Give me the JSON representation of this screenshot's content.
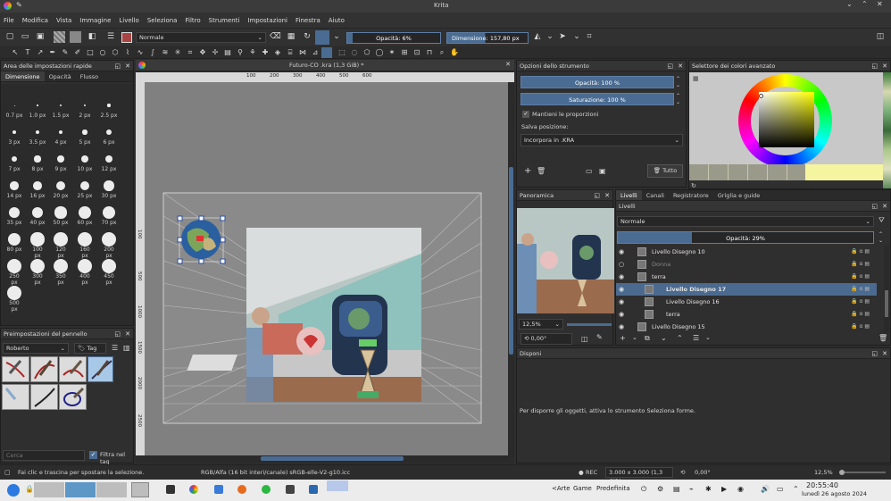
{
  "window": {
    "title": "Krita"
  },
  "menu": [
    "File",
    "Modifica",
    "Vista",
    "Immagine",
    "Livello",
    "Seleziona",
    "Filtro",
    "Strumenti",
    "Impostazioni",
    "Finestra",
    "Aiuto"
  ],
  "toolbar": {
    "blend_mode": "Normale",
    "opacity_label": "Opacità: 6%",
    "size_label": "Dimensione:",
    "size_value": "157,80 px"
  },
  "quick_settings": {
    "title": "Area delle impostazioni rapide",
    "tabs": [
      "Dimensione",
      "Opacità",
      "Flusso"
    ],
    "sizes": [
      "0.7 px",
      "1.0 px",
      "1.5 px",
      "2 px",
      "2.5 px",
      "3 px",
      "3.5 px",
      "4 px",
      "5 px",
      "6 px",
      "7 px",
      "8 px",
      "9 px",
      "10 px",
      "12 px",
      "14 px",
      "16 px",
      "20 px",
      "25 px",
      "30 px",
      "35 px",
      "40 px",
      "50 px",
      "60 px",
      "70 px",
      "80 px",
      "100 px",
      "120 px",
      "160 px",
      "200 px",
      "250 px",
      "300 px",
      "350 px",
      "400 px",
      "450 px",
      "500 px"
    ]
  },
  "brush_presets": {
    "title": "Preimpostazioni del pennello",
    "preset_select": "Roberto",
    "tag_select": "Tag",
    "search_placeholder": "Cerca",
    "filter_label": "Filtra nel tag"
  },
  "document": {
    "tab_title": "Futuro-CO .kra (1,3 GiB) *",
    "ruler_h": [
      "100",
      "200",
      "300",
      "400",
      "500",
      "600"
    ],
    "ruler_v": [
      "100",
      "500",
      "1000",
      "1500",
      "2000",
      "2500"
    ]
  },
  "tool_options": {
    "title": "Opzioni dello strumento",
    "opacity": "Opacità: 100 %",
    "saturation": "Saturazione: 100 %",
    "keep_proportions": "Mantieni le proporzioni",
    "save_position_label": "Salva posizione:",
    "save_position_value": "Incorpora in .KRA",
    "all_button": "Tutto"
  },
  "color_selector": {
    "title": "Selettore dei colori avanzato",
    "hue_color": "#ffff00"
  },
  "overview": {
    "title": "Panoramica",
    "zoom": "12,5%",
    "rotation": "0,00°"
  },
  "layers": {
    "tabs": [
      "Livelli",
      "Canali",
      "Registratore",
      "Griglia e guide"
    ],
    "header": "Livelli",
    "blend": "Normale",
    "opacity": "Opacità:  29%",
    "items": [
      {
        "name": "Livello Disegno 10",
        "visible": true,
        "selected": false,
        "indent": 0
      },
      {
        "name": "Donna",
        "visible": false,
        "selected": false,
        "indent": 0
      },
      {
        "name": "terra",
        "visible": true,
        "selected": false,
        "indent": 0
      },
      {
        "name": "Livello Disegno 17",
        "visible": true,
        "selected": true,
        "indent": 1
      },
      {
        "name": "Livello Disegno 16",
        "visible": true,
        "selected": false,
        "indent": 1
      },
      {
        "name": "terra",
        "visible": true,
        "selected": false,
        "indent": 1
      },
      {
        "name": "Livello Disegno 15",
        "visible": true,
        "selected": false,
        "indent": 0
      }
    ],
    "footer_rotation": "0,00°"
  },
  "arrange": {
    "title": "Disponi",
    "hint": "Per disporre gli oggetti, attiva lo strumento Seleziona forme."
  },
  "status": {
    "hint": "Fai clic e trascina per spostare la selezione.",
    "color_model": "RGB/Alfa (16 bit interi/canale)  sRGB-elle-V2-g10.icc",
    "rec": "REC",
    "image_size": "3.000 x 3.000 (1,3 GiB)",
    "rotation": "0,00°",
    "zoom": "12,5%"
  },
  "taskbar": {
    "items": [
      "<Arte",
      "Game",
      "Predefinita"
    ],
    "time": "20:55:40",
    "date": "lunedì 26 agosto 2024"
  }
}
